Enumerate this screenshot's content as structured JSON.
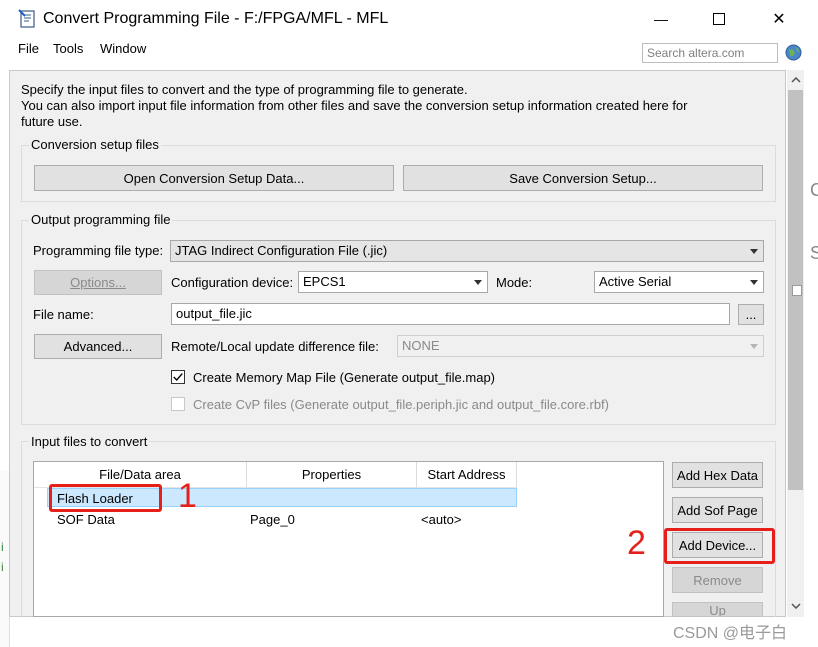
{
  "window": {
    "title": "Convert Programming File - F:/FPGA/MFL - MFL",
    "minimize_glyph": "—",
    "maximize_glyph": "☐",
    "close_glyph": "✕"
  },
  "menu": {
    "items": [
      "File",
      "Tools",
      "Window"
    ],
    "search_placeholder": "Search altera.com"
  },
  "description": {
    "line1": "Specify the input files to convert and the type of programming file to generate.",
    "line2": "You can also import input file information from other files and save the conversion setup information created here for",
    "line3": "future use."
  },
  "conversion_setup": {
    "title": "Conversion setup files",
    "open_button": "Open Conversion Setup Data...",
    "save_button": "Save Conversion Setup..."
  },
  "output": {
    "title": "Output programming file",
    "file_type_label": "Programming file type:",
    "file_type_value": "JTAG Indirect Configuration File (.jic)",
    "options_button": "Options...",
    "config_device_label": "Configuration device:",
    "config_device_value": "EPCS1",
    "mode_label": "Mode:",
    "mode_value": "Active Serial",
    "file_name_label": "File name:",
    "file_name_value": "output_file.jic",
    "browse_button": "...",
    "advanced_button": "Advanced...",
    "remote_label": "Remote/Local update difference file:",
    "remote_value": "NONE",
    "memory_map_label": "Create Memory Map File (Generate output_file.map)",
    "memory_map_checked": true,
    "cvp_label": "Create CvP files (Generate output_file.periph.jic and output_file.core.rbf)"
  },
  "input": {
    "title": "Input files to convert",
    "columns": [
      "File/Data area",
      "Properties",
      "Start Address"
    ],
    "rows": [
      {
        "area": "Flash Loader",
        "properties": "",
        "start": ""
      },
      {
        "area": "SOF Data",
        "properties": "Page_0",
        "start": "<auto>"
      }
    ],
    "add_hex_button": "Add Hex Data",
    "add_sof_button": "Add Sof Page",
    "add_device_button": "Add Device...",
    "remove_button": "Remove",
    "up_button": "Up"
  },
  "annotations": {
    "num1": "1",
    "num2": "2"
  },
  "watermark": "CSDN @电子白",
  "colors": {
    "annotation_red": "#e5201b",
    "selection": "#cce8ff"
  }
}
